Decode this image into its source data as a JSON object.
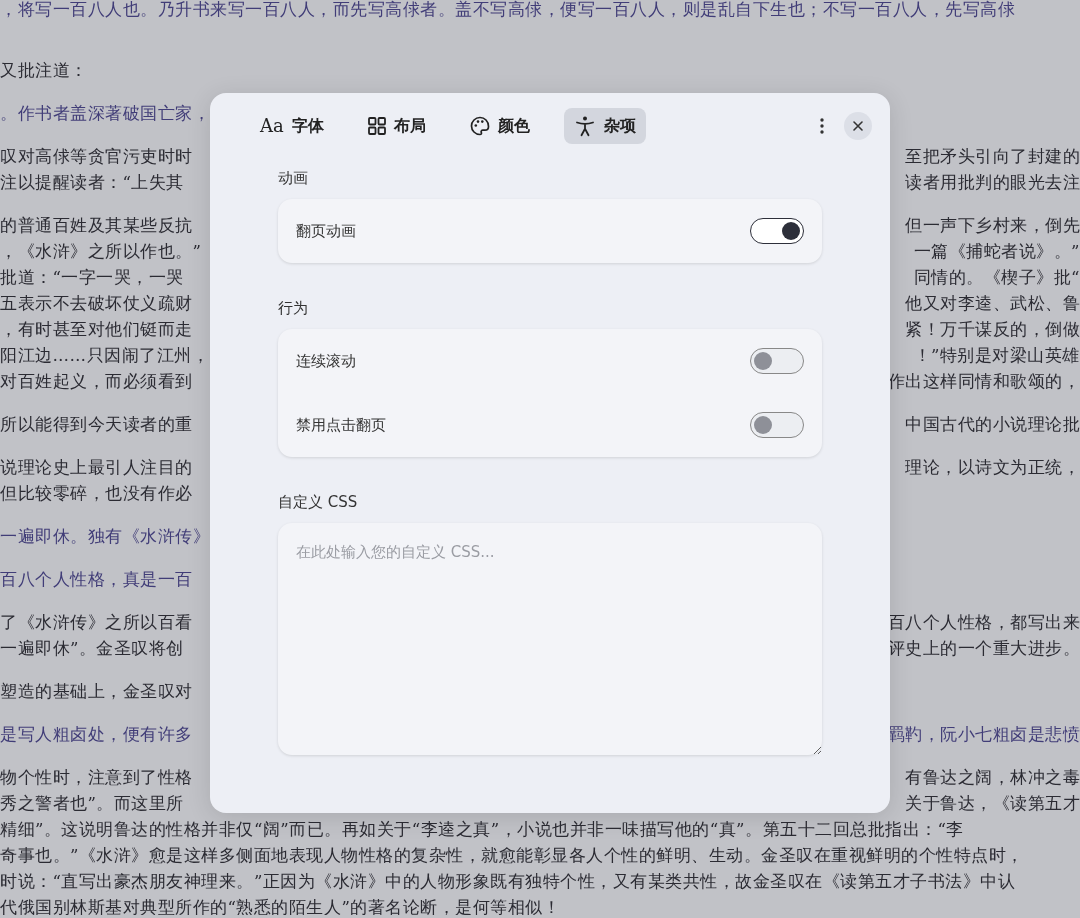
{
  "background_text": {
    "paragraphs": [
      {
        "kind": "quote",
        "lines": [
          {
            "text": "，将写一百八人也。乃升书来写一百八人，而先写高俅者。盖不写高俅，便写一百八人，则是乱自下生也；不写一百八人，先写高俅"
          }
        ]
      },
      {
        "kind": "body",
        "lines": [
          {
            "left": "又批注道："
          }
        ]
      },
      {
        "kind": "quote",
        "lines": [
          {
            "left": "。作书者盖深著破国亡家，"
          }
        ]
      },
      {
        "kind": "body",
        "lines": [
          {
            "left": "叹对高俅等贪官污吏时时",
            "right": "至把矛头引向了封建的"
          },
          {
            "left": "注以提醒读者：“上失其",
            "right": "读者用批判的眼光去注"
          }
        ]
      },
      {
        "kind": "body",
        "lines": [
          {
            "left": "的普通百姓及其某些反抗",
            "right": "但一声下乡村来，倒先"
          },
          {
            "left": "，《水浒》之所以作也。”",
            "right": "一篇《捕蛇者说》。”"
          },
          {
            "left": "批道：“一字一哭，一哭",
            "right": "同情的。《楔子》批“"
          },
          {
            "left": "五表示不去破坏仗义疏财",
            "right": "他又对李逵、武松、鲁"
          },
          {
            "left": "，有时甚至对他们铤而走",
            "right": "紧！万千谋反的，倒做"
          },
          {
            "left": "阳江边……只因闹了江州，",
            "right": "！”特别是对梁山英雄"
          },
          {
            "left": "对百姓起义，而必须看到",
            "right": "作出这样同情和歌颂的，"
          }
        ]
      },
      {
        "kind": "body",
        "lines": [
          {
            "left": "所以能得到今天读者的重",
            "right": "中国古代的小说理论批"
          }
        ]
      },
      {
        "kind": "body",
        "lines": [
          {
            "left": "说理论史上最引人注目的",
            "right": "理论，以诗文为正统，"
          },
          {
            "left": "但比较零碎，也没有作必"
          }
        ]
      },
      {
        "kind": "quote",
        "lines": [
          {
            "left": "一遍即休。独有《水浒传》"
          }
        ]
      },
      {
        "kind": "quote",
        "lines": [
          {
            "left": "百八个人性格，真是一百"
          }
        ]
      },
      {
        "kind": "body",
        "lines": [
          {
            "left": "了《水浒传》之所以百看",
            "right": "百八个人性格，都写出来"
          },
          {
            "left": "一遍即休”。金圣叹将创",
            "right": "评史上的一个重大进步。"
          }
        ]
      },
      {
        "kind": "body",
        "lines": [
          {
            "left": "塑造的基础上，金圣叹对"
          }
        ]
      },
      {
        "kind": "quote",
        "lines": [
          {
            "left": "是写人粗卤处，便有许多",
            "right": "羁靮，阮小七粗卤是悲愤"
          }
        ]
      },
      {
        "kind": "body",
        "lines": [
          {
            "left": "物个性时，注意到了性格",
            "right": "有鲁达之阔，林冲之毒"
          },
          {
            "left": "秀之警者也”。而这里所",
            "right": "关于鲁达，《读第五才"
          },
          {
            "text": "精细”。这说明鲁达的性格并非仅“阔”而已。再如关于“李逵之真”，小说也并非一味描写他的“真”。第五十二回总批指出：“李"
          },
          {
            "text": "奇事也。”《水浒》愈是这样多侧面地表现人物性格的复杂性，就愈能彰显各人个性的鲜明、生动。金圣叹在重视鲜明的个性特点时，"
          },
          {
            "text": "时说：“直写出豪杰朋友神理来。”正因为《水浒》中的人物形象既有独特个性，又有某类共性，故金圣叹在《读第五才子书法》中认"
          },
          {
            "text": "代俄国别林斯基对典型所作的“熟悉的陌生人”的著名论断，是何等相似！"
          }
        ]
      }
    ]
  },
  "dialog": {
    "tabs": [
      {
        "label": "字体",
        "glyph": "Aa",
        "selected": false
      },
      {
        "label": "布局",
        "selected": false
      },
      {
        "label": "颜色",
        "selected": false
      },
      {
        "label": "杂项",
        "selected": true
      }
    ],
    "sections": [
      {
        "title": "动画",
        "kind": "toggles",
        "rows": [
          {
            "label": "翻页动画",
            "on": true
          }
        ]
      },
      {
        "title": "行为",
        "kind": "toggles",
        "rows": [
          {
            "label": "连续滚动",
            "on": false
          },
          {
            "label": "禁用点击翻页",
            "on": false
          }
        ]
      },
      {
        "title": "自定义 CSS",
        "kind": "textarea",
        "placeholder": "在此处输入您的自定义 CSS..."
      }
    ]
  }
}
